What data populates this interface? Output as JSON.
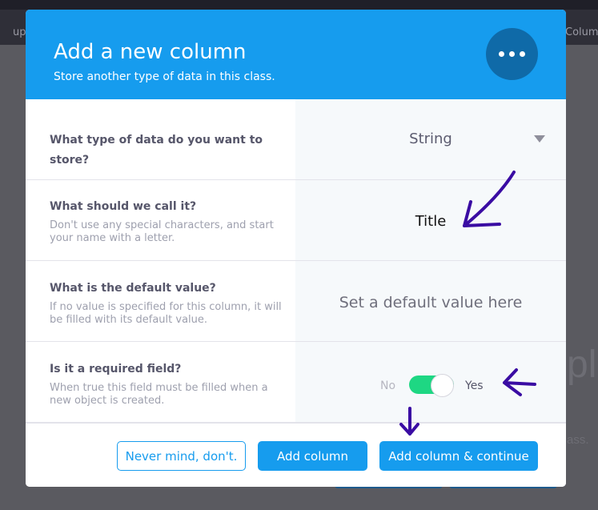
{
  "background": {
    "toolbar_left_text": "up",
    "toolbar_right_text": "Column",
    "big_text": "pla",
    "small_text": "ass."
  },
  "modal": {
    "title": "Add a new column",
    "subtitle": "Store another type of data in this class.",
    "menu_icon": "more-dots-icon",
    "header_color": "#169cee"
  },
  "fields": {
    "type": {
      "label": "What type of data do you want to store?",
      "value": "String"
    },
    "name": {
      "label": "What should we call it?",
      "description": "Don't use any special characters, and start your name with a letter.",
      "value": "Title"
    },
    "default": {
      "label": "What is the default value?",
      "description": "If no value is specified for this column, it will be filled with its default value.",
      "placeholder": "Set a default value here"
    },
    "required": {
      "label": "Is it a required field?",
      "description": "When true this field must be filled when a new object is created.",
      "off_label": "No",
      "on_label": "Yes",
      "enabled": true,
      "toggle_color": "#1ed783"
    }
  },
  "footer": {
    "cancel_label": "Never mind, don't.",
    "add_label": "Add column",
    "add_continue_label": "Add column & continue"
  },
  "annotation_color": "#3a0ca3"
}
